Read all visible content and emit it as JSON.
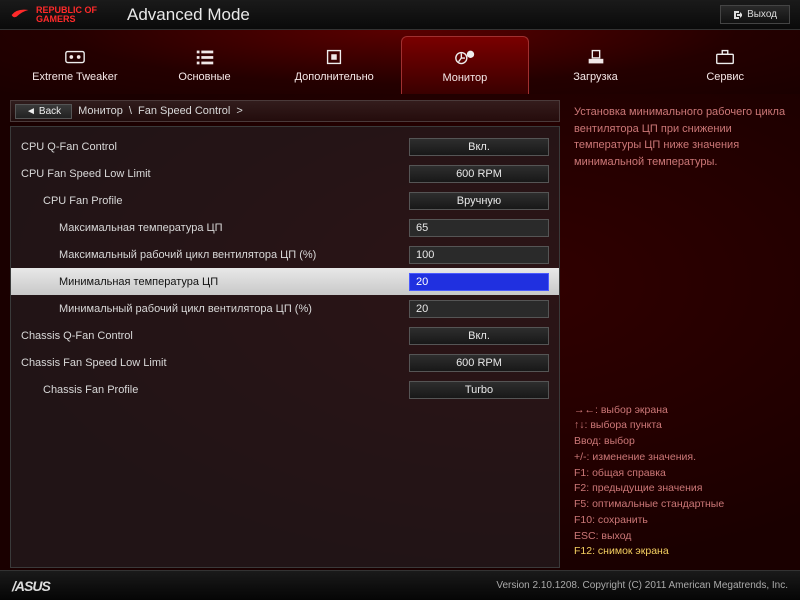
{
  "header": {
    "brand_line1": "REPUBLIC OF",
    "brand_line2": "GAMERS",
    "mode_title": "Advanced Mode",
    "exit_label": "Выход"
  },
  "tabs": [
    {
      "label": "Extreme Tweaker"
    },
    {
      "label": "Основные"
    },
    {
      "label": "Дополнительно"
    },
    {
      "label": "Монитор"
    },
    {
      "label": "Загрузка"
    },
    {
      "label": "Сервис"
    }
  ],
  "active_tab_index": 3,
  "breadcrumb": {
    "back_label": "Back",
    "parent": "Монитор",
    "current": "Fan Speed Control"
  },
  "help_text": "Установка минимального рабочего цикла вентилятора ЦП при снижении температуры ЦП ниже значения минимальной температуры.",
  "settings": [
    {
      "label": "CPU Q-Fan Control",
      "value": "Вкл.",
      "kind": "select",
      "indent": 0
    },
    {
      "label": "CPU Fan Speed Low Limit",
      "value": "600 RPM",
      "kind": "select",
      "indent": 0
    },
    {
      "label": "CPU Fan Profile",
      "value": "Вручную",
      "kind": "select",
      "indent": 1
    },
    {
      "label": "Максимальная температура ЦП",
      "value": "65",
      "kind": "input",
      "indent": 2
    },
    {
      "label": "Максимальный рабочий цикл вентилятора ЦП (%)",
      "value": "100",
      "kind": "input",
      "indent": 2
    },
    {
      "label": "Минимальная температура ЦП",
      "value": "20",
      "kind": "input",
      "indent": 2,
      "selected": true
    },
    {
      "label": "Минимальный рабочий цикл вентилятора ЦП (%)",
      "value": "20",
      "kind": "input",
      "indent": 2
    },
    {
      "label": "Chassis Q-Fan Control",
      "value": "Вкл.",
      "kind": "select",
      "indent": 0
    },
    {
      "label": "Chassis Fan Speed Low Limit",
      "value": "600 RPM",
      "kind": "select",
      "indent": 0
    },
    {
      "label": "Chassis Fan Profile",
      "value": "Turbo",
      "kind": "select",
      "indent": 1
    }
  ],
  "key_hints": [
    {
      "key": "→←:",
      "desc": "выбор экрана"
    },
    {
      "key": "↑↓:",
      "desc": "выбора пункта"
    },
    {
      "key": "Ввод:",
      "desc": "выбор"
    },
    {
      "key": "+/-:",
      "desc": "изменение значения."
    },
    {
      "key": "F1:",
      "desc": "общая справка"
    },
    {
      "key": "F2:",
      "desc": "предыдущие значения"
    },
    {
      "key": "F5:",
      "desc": "оптимальные стандартные"
    },
    {
      "key": "F10:",
      "desc": "сохранить"
    },
    {
      "key": "ESC:",
      "desc": "выход"
    },
    {
      "key": "F12:",
      "desc": "снимок экрана",
      "hl": true
    }
  ],
  "footer": {
    "brand": "/ASUS",
    "version": "Version 2.10.1208. Copyright (C) 2011 American Megatrends, Inc."
  }
}
